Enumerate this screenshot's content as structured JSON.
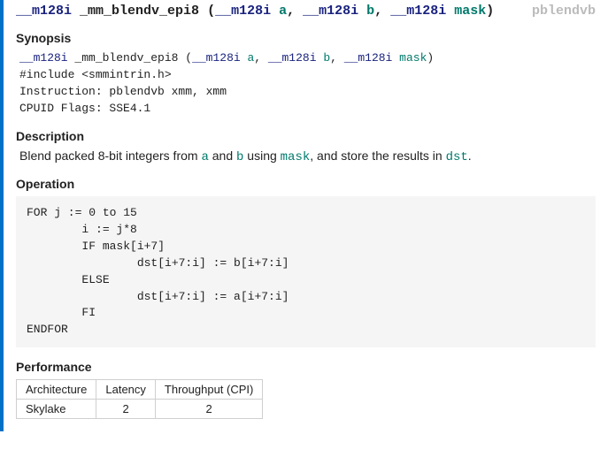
{
  "signature": {
    "ret_type": "__m128i",
    "name": "_mm_blendv_epi8",
    "params": [
      {
        "type": "__m128i",
        "name": "a"
      },
      {
        "type": "__m128i",
        "name": "b"
      },
      {
        "type": "__m128i",
        "name": "mask"
      }
    ],
    "instruction_tag": "pblendvb"
  },
  "sections": {
    "synopsis": {
      "title": "Synopsis",
      "include_line": "#include <smmintrin.h>",
      "instruction_line": "Instruction: pblendvb xmm, xmm",
      "cpuid_line": "CPUID Flags: SSE4.1"
    },
    "description": {
      "title": "Description",
      "text_prefix": "Blend packed 8-bit integers from ",
      "var_a": "a",
      "text_mid1": " and ",
      "var_b": "b",
      "text_mid2": " using ",
      "var_mask": "mask",
      "text_mid3": ", and store the results in ",
      "var_dst": "dst",
      "text_suffix": "."
    },
    "operation": {
      "title": "Operation",
      "code": "FOR j := 0 to 15\n        i := j*8\n        IF mask[i+7]\n                dst[i+7:i] := b[i+7:i]\n        ELSE\n                dst[i+7:i] := a[i+7:i]\n        FI\nENDFOR"
    },
    "performance": {
      "title": "Performance",
      "headers": [
        "Architecture",
        "Latency",
        "Throughput (CPI)"
      ],
      "rows": [
        {
          "arch": "Skylake",
          "latency": "2",
          "throughput": "2"
        }
      ]
    }
  }
}
